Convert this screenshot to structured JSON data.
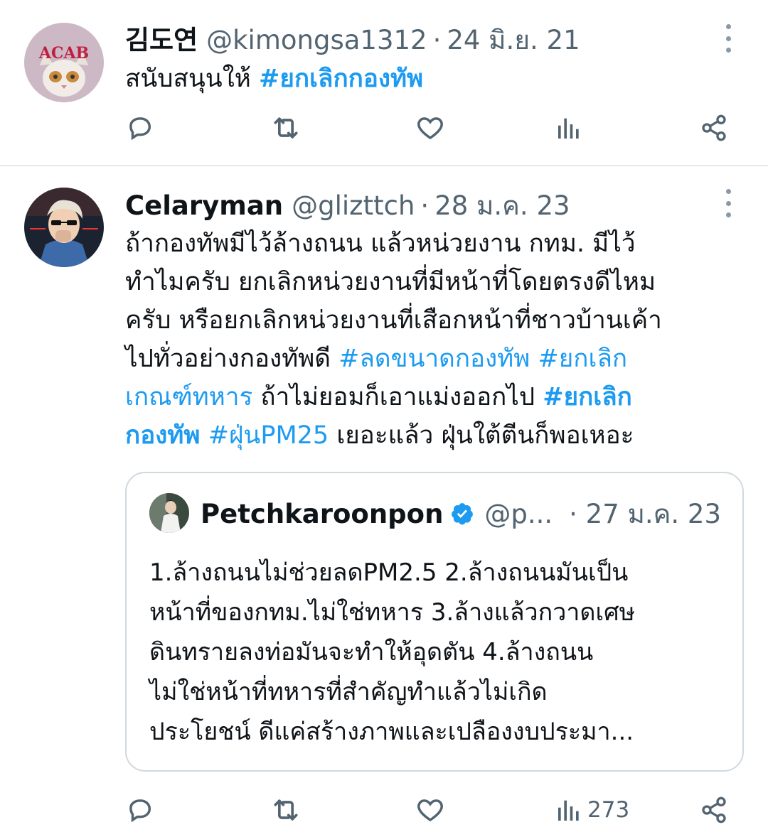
{
  "tweets": [
    {
      "name": "김도연",
      "handle": "@kimongsa1312",
      "separator": "·",
      "date": "24 มิ.ย. 21",
      "avatar_icon": "cat-avatar",
      "body": {
        "line1_text": "สนับสนุนให้ ",
        "line1_tag": "#ยกเลิกกองทัพ"
      },
      "views": ""
    },
    {
      "name": "Celaryman",
      "handle": "@glizttch",
      "separator": "·",
      "date": "28 ม.ค. 23",
      "avatar_icon": "anime-character-avatar",
      "body": {
        "line1": "ถ้ากองทัพมีไว้ล้างถนน แล้วหน่วยงาน  กทม. มีไว้",
        "line2": "ทำไมครับ ยกเลิกหน่วยงานที่มีหน้าที่โดยตรงดีไหม",
        "line3": "ครับ หรือยกเลิกหน่วยงานที่เสือกหน้าที่ชาวบ้านเค้า",
        "line4_text": "ไปทั่วอย่างกองทัพดี ",
        "line4_tag1": "#ลดขนาดกองทัพ",
        "line4_tag2": "#ยกเลิก",
        "line5_tag": "เกณฑ์ทหาร",
        "line5_text": " ถ้าไม่ยอมก็เอาแม่งออกไป ",
        "line5_tag2": "#ยกเลิก",
        "line6_tag1": "กองทัพ",
        "line6_tag2": "#ฝุ่นPM25",
        "line6_text": " เยอะแล้ว ฝุ่นใต้ตีนก็พอเหอะ"
      },
      "quote": {
        "name": "Petchkaroonpon",
        "handle": "@p...",
        "date": "· 27 ม.ค. 23",
        "verified_icon": "verified-badge-icon",
        "lines": [
          "1.ล้างถนนไม่ช่วยลดPM2.5 2.ล้างถนนมันเป็น",
          "หน้าที่ของกทม.ไม่ใช่ทหาร 3.ล้างแล้วกวาดเศษ",
          "ดินทรายลงท่อมันจะทำให้อุดตัน 4.ล้างถนน",
          "ไม่ใช่หน้าที่ทหารที่สำคัญทำแล้วไม่เกิด",
          "ประโยชน์ ดีแค่สร้างภาพและเปลืองงบประมา..."
        ]
      },
      "views": "273"
    }
  ],
  "actions": {
    "reply_icon": "reply-icon",
    "retweet_icon": "retweet-icon",
    "like_icon": "like-icon",
    "views_icon": "views-icon",
    "share_icon": "share-icon"
  },
  "colors": {
    "link": "#1d9bf0",
    "muted": "#536471",
    "border": "#cfd9de",
    "verified": "#1d9bf0"
  }
}
